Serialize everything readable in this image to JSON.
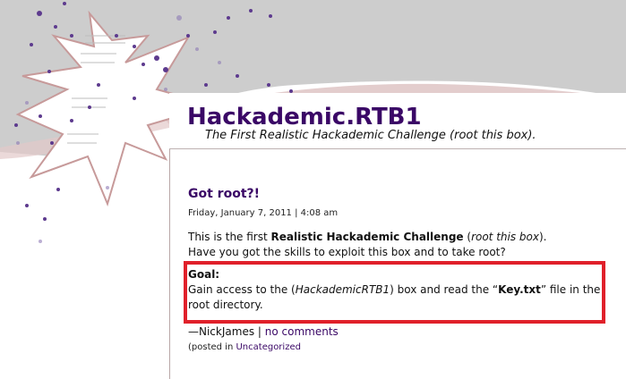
{
  "site": {
    "title": "Hackademic.RTB1",
    "description": "The First Realistic Hackademic Challenge (root this box)."
  },
  "post": {
    "title": "Got root?!",
    "date": "Friday, January 7, 2011 | 4:08 am",
    "intro": {
      "prefix": "This is the first ",
      "bold": "Realistic Hackademic Challenge",
      "mid": " (",
      "italic": "root this box",
      "suffix": ").",
      "line2": "Have you got the skills to exploit this box and to take root?"
    },
    "goal": {
      "label": "Goal:",
      "prefix": "Gain access to the (",
      "italic": "HackademicRTB1",
      "mid": ") box and read the “",
      "bold": "Key.txt",
      "suffix": "” file in the root directory."
    },
    "author_prefix": "—NickJames | ",
    "comments_link": "no comments",
    "posted_prefix": "(posted in ",
    "category_link": "Uncategorized"
  },
  "colors": {
    "title": "#3a0766",
    "highlight_border": "#e0202a"
  }
}
